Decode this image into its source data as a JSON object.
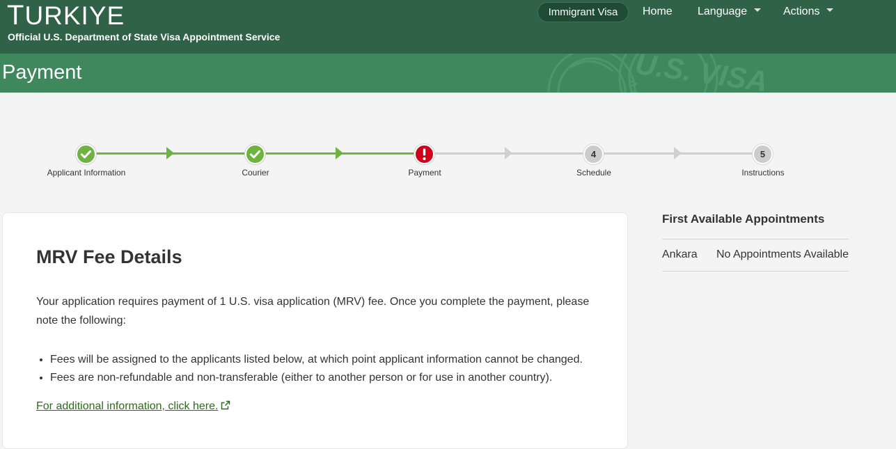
{
  "header": {
    "country_first": "T",
    "country_rest": "URKIYE",
    "subtitle": "Official U.S. Department of State Visa Appointment Service",
    "background_color": "#2f6246"
  },
  "nav": {
    "visa_type": "Immigrant Visa",
    "home": "Home",
    "language": "Language",
    "actions": "Actions"
  },
  "page": {
    "title": "Payment",
    "title_band_color": "#3f875d",
    "watermark_text": "U.S. VISA"
  },
  "stepper": {
    "steps": [
      {
        "label": "Applicant Information",
        "status": "complete"
      },
      {
        "label": "Courier",
        "status": "complete"
      },
      {
        "label": "Payment",
        "status": "error"
      },
      {
        "label": "Schedule",
        "status": "pending",
        "number": "4"
      },
      {
        "label": "Instructions",
        "status": "pending",
        "number": "5"
      }
    ],
    "complete_color": "#6db33f",
    "error_color": "#d0021b",
    "pending_color": "#cccccc"
  },
  "fee_details": {
    "title": "MRV Fee Details",
    "intro": "Your application requires payment of 1 U.S. visa application (MRV) fee. Once you complete the payment, please note the following:",
    "bullets": [
      "Fees will be assigned to the applicants listed below, at which point applicant information cannot be changed.",
      "Fees are non-refundable and non-transferable (either to another person or for use in another country)."
    ],
    "link_text": "For additional information, click here."
  },
  "appointments": {
    "title": "First Available Appointments",
    "rows": [
      {
        "city": "Ankara",
        "status": "No Appointments Available"
      }
    ]
  }
}
